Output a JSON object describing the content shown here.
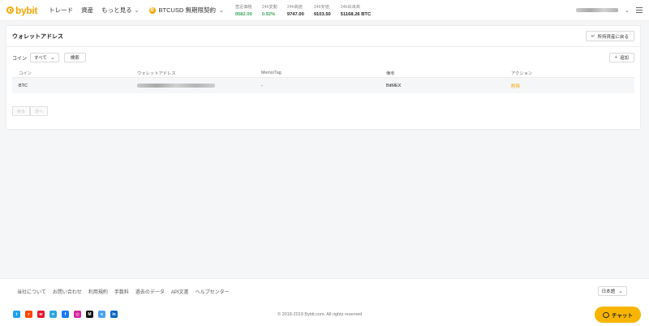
{
  "header": {
    "logo_text": "bybit",
    "nav": [
      {
        "label": "トレード"
      },
      {
        "label": "資産"
      },
      {
        "label": "もっと見る"
      }
    ],
    "contract_icon": "B",
    "contract_label": "BTCUSD 無期限契約",
    "stats": [
      {
        "label": "直近価格",
        "value": "9582.00",
        "color": "#3ba55d"
      },
      {
        "label": "24h変動",
        "value": "0.92%",
        "color": "#3ba55d"
      },
      {
        "label": "24h高値",
        "value": "9747.00"
      },
      {
        "label": "24h安値",
        "value": "9103.50"
      },
      {
        "label": "24h出来高",
        "value": "51168.26 BTC"
      }
    ]
  },
  "card": {
    "title": "ウォレットアドレス",
    "back_label": "所持資産に戻る",
    "filter_label": "コイン",
    "select_value": "すべて",
    "search_label": "検索",
    "add_label": "追加",
    "columns": [
      "コイン",
      "ウォレットアドレス",
      "Memo/Tag",
      "備考",
      "アクション"
    ],
    "rows": [
      {
        "coin": "BTC",
        "memo": "-",
        "note": "BitMEX",
        "action": "削除"
      }
    ],
    "prev_label": "戻る",
    "next_label": "次へ"
  },
  "footer": {
    "links": [
      "当社について",
      "お問い合わせ",
      "利用規約",
      "手数料",
      "過去のデータ",
      "API文書",
      "ヘルプセンター"
    ],
    "language": "日本語",
    "copyright": "© 2018-2019 Bybit.com. All rights reserved",
    "social": [
      {
        "icon": "twitter-icon",
        "glyph": "t",
        "color": "#1da1f2"
      },
      {
        "icon": "reddit-icon",
        "glyph": "r",
        "color": "#ff4500"
      },
      {
        "icon": "weibo-icon",
        "glyph": "w",
        "color": "#e6162d"
      },
      {
        "icon": "telegram-icon",
        "glyph": "➤",
        "color": "#2ca5e0"
      },
      {
        "icon": "facebook-icon",
        "glyph": "f",
        "color": "#1877f2"
      },
      {
        "icon": "instagram-icon",
        "glyph": "◎",
        "color": "#d6249f"
      },
      {
        "icon": "medium-icon",
        "glyph": "M",
        "color": "#111111"
      },
      {
        "icon": "steemit-icon",
        "glyph": "s",
        "color": "#4ba2f2"
      },
      {
        "icon": "linkedin-icon",
        "glyph": "in",
        "color": "#0a66c2"
      }
    ],
    "chat_label": "チャット"
  },
  "colors": {
    "accent": "#f7a600",
    "positive": "#3ba55d"
  }
}
